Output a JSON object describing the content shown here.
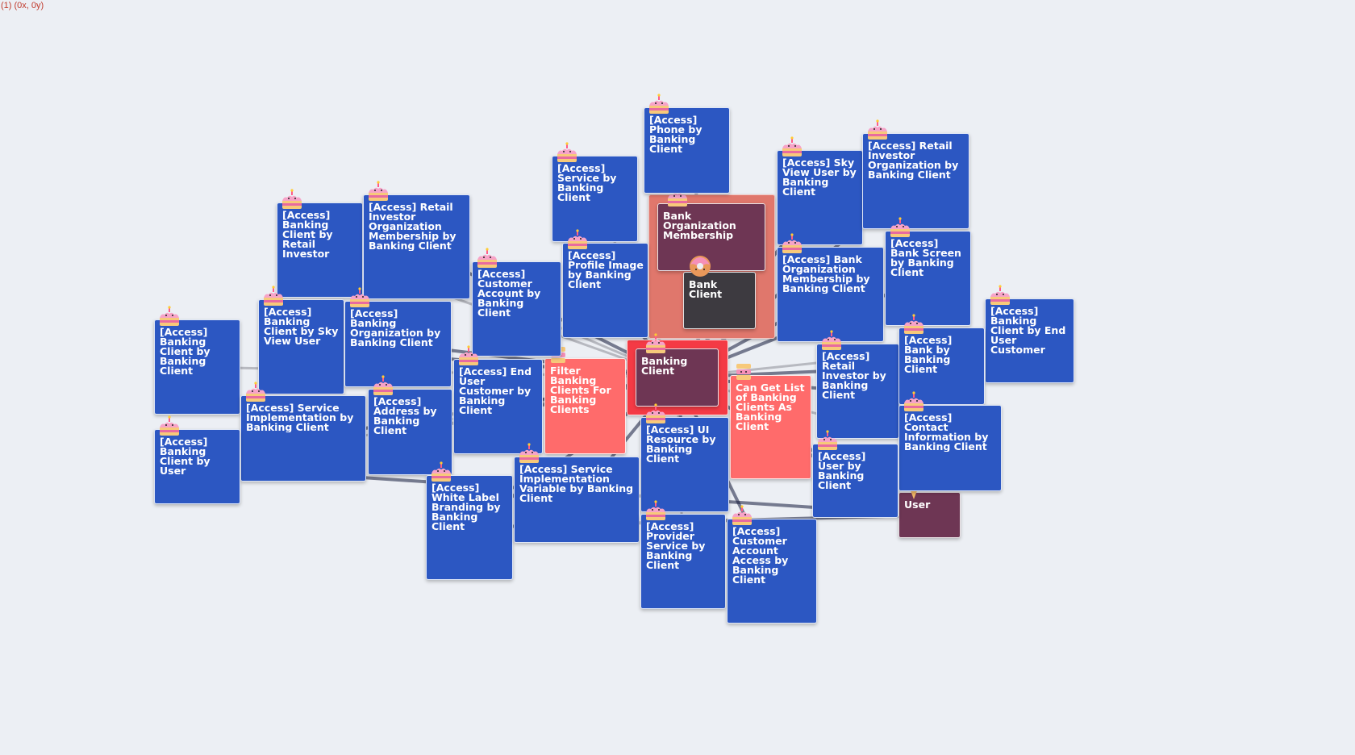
{
  "coords": "(1) (0x, 0y)",
  "nodes": [
    {
      "id": "n_bom",
      "label": "Bank Organization Membership",
      "color": "maroon",
      "icon": "cake-icon"
    },
    {
      "id": "n_bank_client",
      "label": "Bank Client",
      "color": "dark",
      "icon": "donut-icon"
    },
    {
      "id": "n_banking_client",
      "label": "Banking Client",
      "color": "maroon",
      "icon": "cake-icon"
    },
    {
      "id": "n_filter",
      "label": "Filter Banking Clients For Banking Clients",
      "color": "red",
      "icon": "cake-icon"
    },
    {
      "id": "n_canget",
      "label": "Can Get List of Banking Clients As Banking Client",
      "color": "red",
      "icon": "cake-icon"
    },
    {
      "id": "n_user",
      "label": "User",
      "color": "maroon",
      "icon": "ice-cream-icon"
    },
    {
      "id": "n_phone",
      "label": "[Access] Phone by Banking Client",
      "color": "blue",
      "icon": "cake-icon"
    },
    {
      "id": "n_service",
      "label": "[Access] Service by Banking Client",
      "color": "blue",
      "icon": "cake-icon"
    },
    {
      "id": "n_skyview",
      "label": "[Access] Sky View User by Banking Client",
      "color": "blue",
      "icon": "cake-icon"
    },
    {
      "id": "n_retail_org",
      "label": "[Access] Retail Investor Organization by Banking Client",
      "color": "blue",
      "icon": "cake-icon"
    },
    {
      "id": "n_bc_retail",
      "label": "[Access] Banking Client by Retail Investor",
      "color": "blue",
      "icon": "cake-icon"
    },
    {
      "id": "n_retail_mem",
      "label": "[Access] Retail Investor Organization Membership by Banking Client",
      "color": "blue",
      "icon": "cake-icon"
    },
    {
      "id": "n_profile",
      "label": "[Access] Profile Image by Banking Client",
      "color": "blue",
      "icon": "cake-icon"
    },
    {
      "id": "n_cust_acct",
      "label": "[Access] Customer Account by Banking Client",
      "color": "blue",
      "icon": "cake-icon"
    },
    {
      "id": "n_bank_org_mem",
      "label": "[Access] Bank Organization Membership by Banking Client",
      "color": "blue",
      "icon": "cake-icon"
    },
    {
      "id": "n_bank_screen",
      "label": "[Access] Bank Screen by Banking Client",
      "color": "blue",
      "icon": "cake-icon"
    },
    {
      "id": "n_bc_endcust",
      "label": "[Access] Banking Client by End User Customer",
      "color": "blue",
      "icon": "cake-icon"
    },
    {
      "id": "n_bc_skyview",
      "label": "[Access] Banking Client by Sky View User",
      "color": "blue",
      "icon": "cake-icon"
    },
    {
      "id": "n_bank_org",
      "label": "[Access] Banking Organization by Banking Client",
      "color": "blue",
      "icon": "cake-icon"
    },
    {
      "id": "n_bc_bc",
      "label": "[Access] Banking Client by Banking Client",
      "color": "blue",
      "icon": "cake-icon"
    },
    {
      "id": "n_retail_inv",
      "label": "[Access] Retail Investor by Banking Client",
      "color": "blue",
      "icon": "cake-icon"
    },
    {
      "id": "n_bank_bc",
      "label": "[Access] Bank by Banking Client",
      "color": "blue",
      "icon": "cake-icon"
    },
    {
      "id": "n_enduser",
      "label": "[Access] End User Customer by Banking Client",
      "color": "blue",
      "icon": "cake-icon"
    },
    {
      "id": "n_svc_impl",
      "label": "[Access] Service Implementation by Banking Client",
      "color": "blue",
      "icon": "cake-icon"
    },
    {
      "id": "n_address",
      "label": "[Access] Address by Banking Client",
      "color": "blue",
      "icon": "cake-icon"
    },
    {
      "id": "n_contact",
      "label": "[Access] Contact Information by Banking Client",
      "color": "blue",
      "icon": "cake-icon"
    },
    {
      "id": "n_ui",
      "label": "[Access] UI Resource by Banking Client",
      "color": "blue",
      "icon": "cake-icon"
    },
    {
      "id": "n_user_bc",
      "label": "[Access] User by Banking Client",
      "color": "blue",
      "icon": "cake-icon"
    },
    {
      "id": "n_bc_user",
      "label": "[Access] Banking Client by User",
      "color": "blue",
      "icon": "cake-icon"
    },
    {
      "id": "n_white",
      "label": "[Access] White Label Branding by Banking Client",
      "color": "blue",
      "icon": "cake-icon"
    },
    {
      "id": "n_svc_var",
      "label": "[Access] Service Implementation Variable by Banking Client",
      "color": "blue",
      "icon": "cake-icon"
    },
    {
      "id": "n_provider",
      "label": "[Access] Provider Service by Banking Client",
      "color": "blue",
      "icon": "cake-icon"
    },
    {
      "id": "n_cust_acct_access",
      "label": "[Access] Customer Account Access by Banking Client",
      "color": "blue",
      "icon": "cake-icon"
    }
  ],
  "edges": [
    [
      "n_phone",
      "n_bank_client"
    ],
    [
      "n_service",
      "n_banking_client"
    ],
    [
      "n_skyview",
      "n_banking_client"
    ],
    [
      "n_retail_org",
      "n_banking_client"
    ],
    [
      "n_bc_retail",
      "n_banking_client"
    ],
    [
      "n_retail_mem",
      "n_banking_client"
    ],
    [
      "n_profile",
      "n_banking_client"
    ],
    [
      "n_cust_acct",
      "n_banking_client"
    ],
    [
      "n_bank_org_mem",
      "n_banking_client"
    ],
    [
      "n_bank_screen",
      "n_banking_client"
    ],
    [
      "n_bc_endcust",
      "n_banking_client"
    ],
    [
      "n_bc_skyview",
      "n_banking_client"
    ],
    [
      "n_bank_org",
      "n_banking_client"
    ],
    [
      "n_bc_bc",
      "n_banking_client"
    ],
    [
      "n_retail_inv",
      "n_banking_client"
    ],
    [
      "n_bank_bc",
      "n_banking_client"
    ],
    [
      "n_enduser",
      "n_banking_client"
    ],
    [
      "n_svc_impl",
      "n_banking_client"
    ],
    [
      "n_address",
      "n_banking_client"
    ],
    [
      "n_contact",
      "n_banking_client"
    ],
    [
      "n_ui",
      "n_banking_client"
    ],
    [
      "n_user_bc",
      "n_banking_client"
    ],
    [
      "n_bc_user",
      "n_banking_client"
    ],
    [
      "n_white",
      "n_banking_client"
    ],
    [
      "n_svc_var",
      "n_banking_client"
    ],
    [
      "n_provider",
      "n_banking_client"
    ],
    [
      "n_cust_acct_access",
      "n_banking_client"
    ],
    [
      "n_banking_client",
      "n_bank_client"
    ],
    [
      "n_bank_client",
      "n_bom"
    ],
    [
      "n_canget",
      "n_user"
    ],
    [
      "n_bc_user",
      "n_user"
    ],
    [
      "n_user_bc",
      "n_user"
    ],
    [
      "n_white",
      "n_user"
    ]
  ]
}
